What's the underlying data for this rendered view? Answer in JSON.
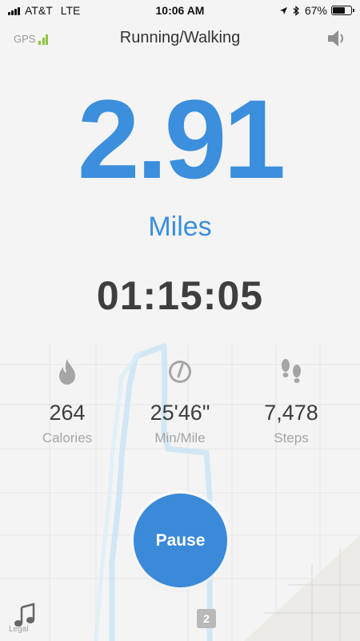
{
  "status_bar": {
    "carrier": "AT&T",
    "network": "LTE",
    "time": "10:06 AM",
    "battery": "67%",
    "battery_level": 0.67,
    "icons": [
      "location-arrow-icon",
      "bluetooth-icon",
      "battery-icon"
    ]
  },
  "header": {
    "gps_label": "GPS",
    "title": "Running/Walking",
    "sound_icon": "speaker-icon"
  },
  "workout": {
    "distance": "2.91",
    "unit": "Miles",
    "elapsed": "01:15:05"
  },
  "stats": [
    {
      "icon": "flame-icon",
      "value": "264",
      "label": "Calories"
    },
    {
      "icon": "speedometer-icon",
      "value": "25'46\"",
      "label": "Min/Mile"
    },
    {
      "icon": "footprints-icon",
      "value": "7,478",
      "label": "Steps"
    }
  ],
  "controls": {
    "pause_label": "Pause",
    "music_icon": "music-note-icon"
  },
  "map": {
    "legal": "Legal",
    "badge": "2"
  },
  "colors": {
    "accent": "#3b8fdc",
    "gps_signal": "#8cc63f",
    "route": "#cde6f5"
  }
}
